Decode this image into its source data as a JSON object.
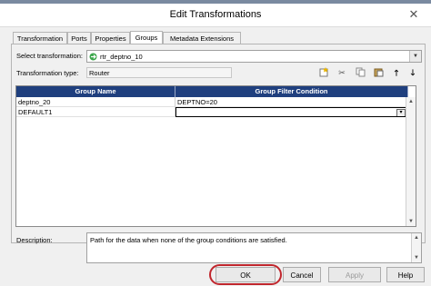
{
  "window": {
    "title": "Edit Transformations",
    "close_glyph": "✕"
  },
  "tabs": [
    {
      "label": "Transformation"
    },
    {
      "label": "Ports"
    },
    {
      "label": "Properties"
    },
    {
      "label": "Groups",
      "active": true
    },
    {
      "label": "Metadata Extensions"
    }
  ],
  "select_transformation": {
    "label": "Select transformation:",
    "value": "rtr_deptno_10",
    "icon": "router-icon"
  },
  "transformation_type": {
    "label": "Transformation type:",
    "value": "Router"
  },
  "toolbar_icons": [
    "new-group-icon",
    "cut-icon",
    "copy-icon",
    "paste-icon",
    "move-up-icon",
    "move-down-icon"
  ],
  "grid": {
    "columns": [
      "Group Name",
      "Group Filter Condition"
    ],
    "rows": [
      {
        "name": "deptno_20",
        "condition": "DEPTNO=20"
      },
      {
        "name": "DEFAULT1",
        "condition": ""
      }
    ]
  },
  "description": {
    "label": "Description:",
    "value": "Path for the data when none of the group conditions are satisfied."
  },
  "buttons": {
    "ok": "OK",
    "cancel": "Cancel",
    "apply": "Apply",
    "help": "Help"
  },
  "colors": {
    "header_bg": "#1f3f7e",
    "highlight": "#c0262d"
  }
}
